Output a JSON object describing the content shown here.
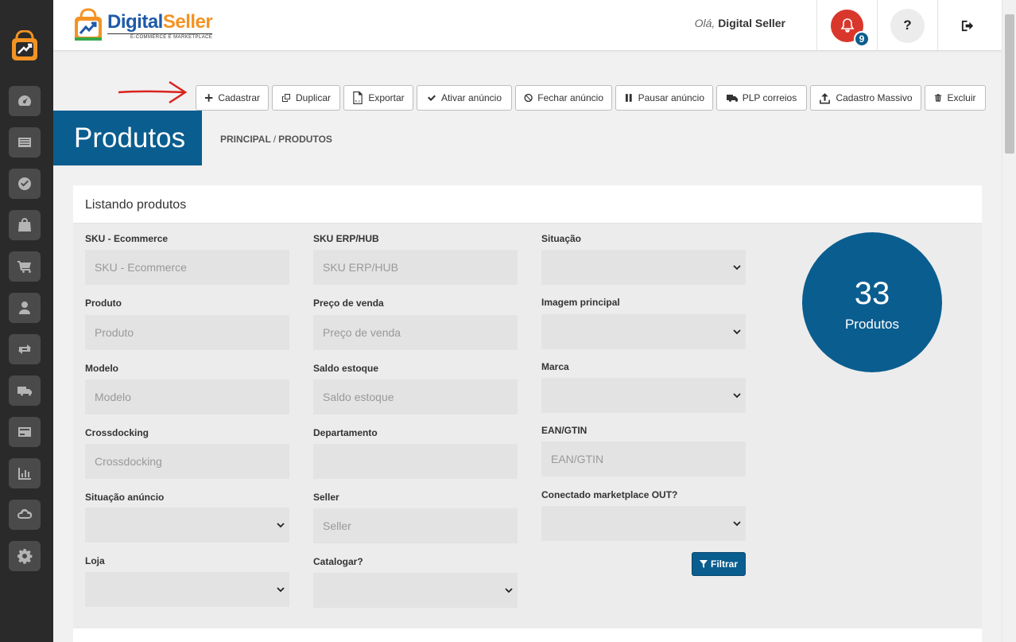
{
  "header": {
    "brand_name_1": "Digital",
    "brand_name_2": "Seller",
    "brand_sub": "E-COMMERCE E MARKETPLACE",
    "greeting_prefix": "Olá,",
    "user_name": "Digital Seller",
    "notification_count": "9",
    "help_label": "?"
  },
  "toolbar": {
    "buttons": [
      {
        "label": "Cadastrar",
        "icon": "plus-icon"
      },
      {
        "label": "Duplicar",
        "icon": "copy-icon"
      },
      {
        "label": "Exportar",
        "icon": "xls-file-icon"
      },
      {
        "label": "Ativar anúncio",
        "icon": "check-icon"
      },
      {
        "label": "Fechar anúncio",
        "icon": "ban-icon"
      },
      {
        "label": "Pausar anúncio",
        "icon": "pause-icon"
      },
      {
        "label": "PLP correios",
        "icon": "truck-icon"
      },
      {
        "label": "Cadastro Massivo",
        "icon": "upload-icon"
      },
      {
        "label": "Excluir",
        "icon": "trash-icon"
      }
    ]
  },
  "page": {
    "title": "Produtos",
    "breadcrumb_1": "PRINCIPAL",
    "breadcrumb_sep": "/",
    "breadcrumb_2": "PRODUTOS"
  },
  "panel": {
    "title": "Listando produtos",
    "fields": {
      "sku_ecommerce": {
        "label": "SKU - Ecommerce",
        "placeholder": "SKU - Ecommerce"
      },
      "sku_erp": {
        "label": "SKU ERP/HUB",
        "placeholder": "SKU ERP/HUB"
      },
      "situacao": {
        "label": "Situação"
      },
      "produto": {
        "label": "Produto",
        "placeholder": "Produto"
      },
      "preco": {
        "label": "Preço de venda",
        "placeholder": "Preço de venda"
      },
      "imagem": {
        "label": "Imagem principal"
      },
      "modelo": {
        "label": "Modelo",
        "placeholder": "Modelo"
      },
      "saldo": {
        "label": "Saldo estoque",
        "placeholder": "Saldo estoque"
      },
      "marca": {
        "label": "Marca"
      },
      "crossdocking": {
        "label": "Crossdocking",
        "placeholder": "Crossdocking"
      },
      "departamento": {
        "label": "Departamento",
        "placeholder": ""
      },
      "ean": {
        "label": "EAN/GTIN",
        "placeholder": "EAN/GTIN"
      },
      "situacao_anuncio": {
        "label": "Situação anúncio"
      },
      "seller": {
        "label": "Seller",
        "placeholder": "Seller"
      },
      "conectado": {
        "label": "Conectado marketplace OUT?"
      },
      "loja": {
        "label": "Loja"
      },
      "catalogar": {
        "label": "Catalogar?"
      }
    },
    "filter_button": "Filtrar",
    "count": {
      "value": "33",
      "label": "Produtos"
    }
  },
  "colors": {
    "primary": "#0a5d8f",
    "sidebar": "#2a2a2a",
    "bell": "#d9372c",
    "arrow": "#d9231f"
  }
}
